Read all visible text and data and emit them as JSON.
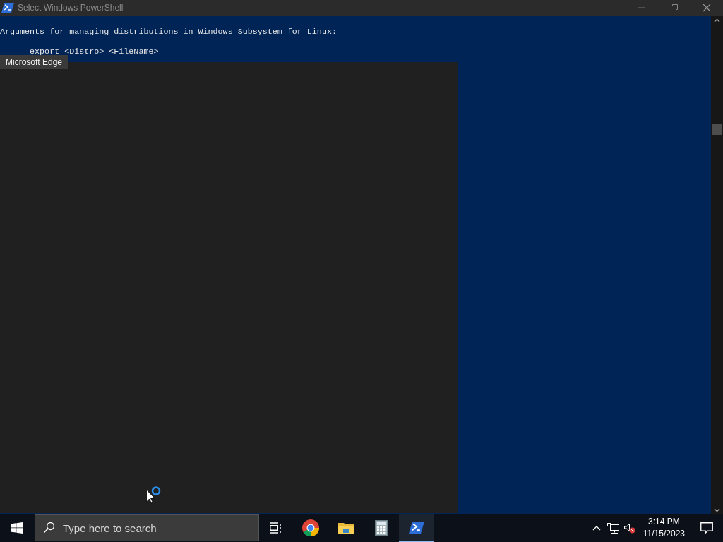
{
  "window": {
    "title": "Select Windows PowerShell"
  },
  "terminal": {
    "blocks": [
      {
        "lines": [
          "Arguments for managing distributions in Windows Subsystem for Linux:"
        ]
      },
      {
        "lines": [
          "    --export <Distro> <FileName>"
        ]
      }
    ]
  },
  "overlay_window": {
    "title": "Microsoft Edge"
  },
  "taskbar": {
    "search": {
      "placeholder": "Type here to search"
    },
    "apps": [
      {
        "kind": "task-view",
        "selected": false
      },
      {
        "kind": "browser",
        "selected": false
      },
      {
        "kind": "folder",
        "selected": false
      },
      {
        "kind": "calculator",
        "selected": false
      },
      {
        "kind": "terminal",
        "selected": true
      }
    ],
    "clock": {
      "time": "3:14 PM",
      "date": "11/15/2023"
    }
  }
}
